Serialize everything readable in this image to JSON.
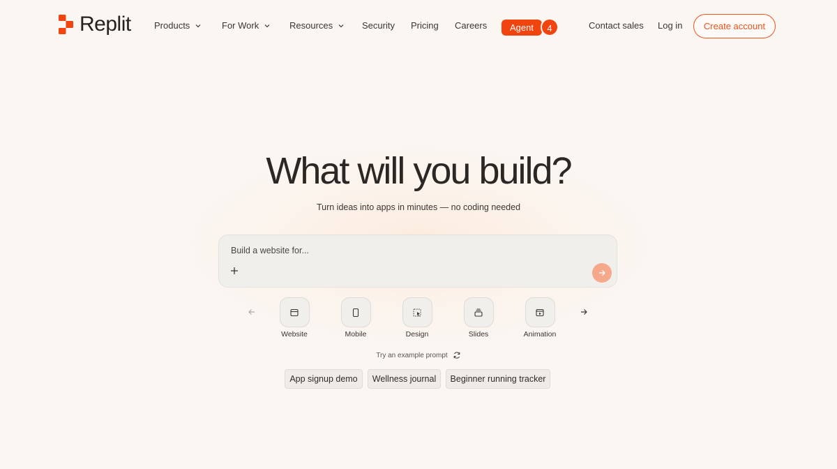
{
  "brand": {
    "name": "Replit",
    "accent": "#f2440f"
  },
  "nav": {
    "products": "Products",
    "for_work": "For Work",
    "resources": "Resources",
    "security": "Security",
    "pricing": "Pricing",
    "careers": "Careers",
    "agent": "Agent",
    "agent_badge": "4"
  },
  "header": {
    "contact_sales": "Contact sales",
    "log_in": "Log in",
    "create_account": "Create account"
  },
  "hero": {
    "title": "What will you build?",
    "subtitle": "Turn ideas into apps in minutes — no coding needed"
  },
  "prompt": {
    "placeholder": "Build a website for..."
  },
  "categories": [
    {
      "label": "Website",
      "icon": "browser-window-icon"
    },
    {
      "label": "Mobile",
      "icon": "mobile-phone-icon"
    },
    {
      "label": "Design",
      "icon": "design-cursor-icon"
    },
    {
      "label": "Slides",
      "icon": "slides-stack-icon"
    },
    {
      "label": "Animation",
      "icon": "animation-play-icon"
    }
  ],
  "examples": {
    "try_label": "Try an example prompt",
    "chips": [
      "App signup demo",
      "Wellness journal",
      "Beginner running tracker"
    ]
  }
}
